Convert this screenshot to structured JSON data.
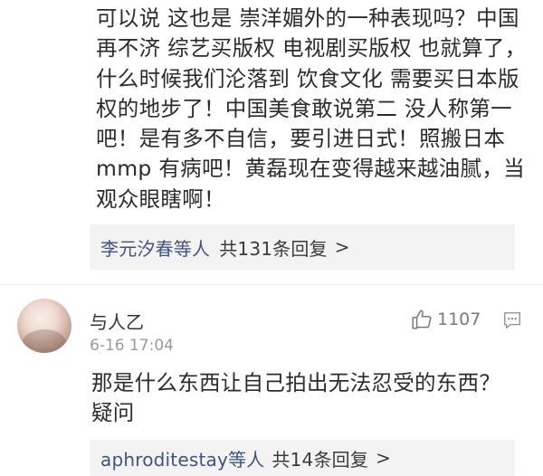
{
  "comment1": {
    "text": "可以说 这也是 崇洋媚外的一种表现吗？中国\n再不济 综艺买版权 电视剧买版权 也就算了，\n什么时候我们沦落到 饮食文化 需要买日本版\n权的地步了！中国美食敢说第二 没人称第一\n吧！是有多不自信，要引进日式！照搬日本\nmmp 有病吧！黄磊现在变得越来越油腻，当\n观众眼瞎啊！",
    "replies": {
      "names": "李元汐春等人",
      "count": "共131条回复",
      "arrow": ">"
    }
  },
  "comment2": {
    "username": "与人乙",
    "timestamp": "6-16 17:04",
    "likes": "1107",
    "like_icon": "thumbs-up-icon",
    "reply_icon": "comment-bubble-icon",
    "text": "那是什么东西让自己拍出无法忍受的东西？\n疑问",
    "replies": {
      "names": "aphroditestay等人",
      "count": "共14条回复",
      "arrow": ">"
    }
  },
  "colors": {
    "link": "#40537e",
    "reply_bg": "#f3f3f4",
    "meta": "#9a9a9a",
    "text": "#2b2b2b"
  }
}
